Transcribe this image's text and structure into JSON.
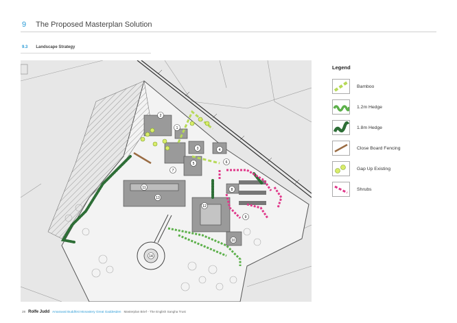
{
  "header": {
    "section_number": "9",
    "section_title": "The Proposed Masterplan Solution"
  },
  "subheader": {
    "number": "9.3",
    "title": "Landscape Strategy"
  },
  "legend": {
    "title": "Legend",
    "items": [
      {
        "label": "Bamboo",
        "icon": "bamboo-swatch"
      },
      {
        "label": "1.2m Hedge",
        "icon": "hedge-1-2m-swatch"
      },
      {
        "label": "1.8m Hedge",
        "icon": "hedge-1-8m-swatch"
      },
      {
        "label": "Close Board Fencing",
        "icon": "fencing-swatch"
      },
      {
        "label": "Gap Up Existing",
        "icon": "gap-up-swatch"
      },
      {
        "label": "Shrubs",
        "icon": "shrubs-swatch"
      }
    ]
  },
  "map_labels": [
    "1",
    "2",
    "3",
    "4",
    "5",
    "6",
    "7",
    "8",
    "9",
    "10",
    "11",
    "12",
    "13",
    "14"
  ],
  "footer": {
    "page": "28",
    "brand": "Rolfe Judd",
    "project": "Amaravati Buddhist Monastery Great Gaddesden",
    "doc": "Masterplan Brief - The English Sangha Trust"
  },
  "colors": {
    "accent": "#2a9bd6",
    "bamboo": "#b6d957",
    "hedge_light": "#5cb04a",
    "hedge_dark": "#2d6e36",
    "fencing": "#9a6c43",
    "gap_up": "#c9e24a",
    "shrubs": "#e0388a"
  }
}
